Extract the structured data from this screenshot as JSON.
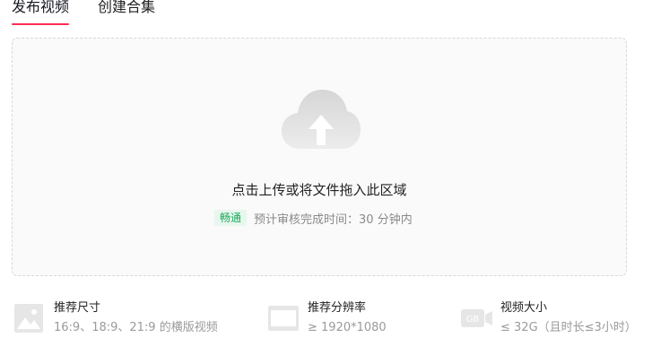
{
  "tabs": [
    {
      "label": "发布视频",
      "active": true
    },
    {
      "label": "创建合集",
      "active": false
    }
  ],
  "upload": {
    "title": "点击上传或将文件拖入此区域",
    "badge": "畅通",
    "note": "预计审核完成时间：30 分钟内"
  },
  "specs": [
    {
      "icon": "image-icon",
      "title": "推荐尺寸",
      "desc": "16:9、18:9、21:9 的横版视频"
    },
    {
      "icon": "screen-icon",
      "title": "推荐分辨率",
      "desc": "≥ 1920*1080"
    },
    {
      "icon": "file-size-icon",
      "title": "视频大小",
      "desc": "≤ 32G（且时长≤3小时）",
      "icon_text": "GB"
    }
  ],
  "colors": {
    "accent": "#fe2c55",
    "badge_bg": "#e8f7ee",
    "badge_text": "#1aab5a"
  }
}
